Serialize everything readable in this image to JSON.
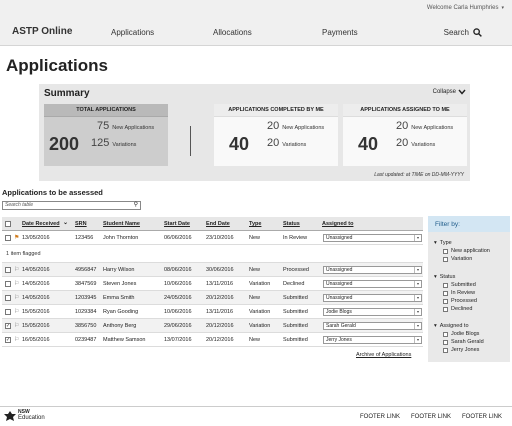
{
  "header": {
    "welcome": "Welcome Carla Humphries",
    "brand": "ASTP Online",
    "nav": [
      "Applications",
      "Allocations",
      "Payments"
    ],
    "search_label": "Search"
  },
  "page_title": "Applications",
  "summary": {
    "title": "Summary",
    "collapse_label": "Collapse",
    "total": {
      "title": "TOTAL APPLICATIONS",
      "count": "200",
      "new_count": "75",
      "new_label": "New Applications",
      "var_count": "125",
      "var_label": "Variations"
    },
    "completed": {
      "title": "APPLICATIONS COMPLETED BY ME",
      "count": "40",
      "new_count": "20",
      "new_label": "New Applications",
      "var_count": "20",
      "var_label": "Variations"
    },
    "assigned": {
      "title": "APPLICATIONS ASSIGNED TO ME",
      "count": "40",
      "new_count": "20",
      "new_label": "New Applications",
      "var_count": "20",
      "var_label": "Variations"
    },
    "last_updated": "Last updated: at TIME on DD-MM-YYYY"
  },
  "assess": {
    "title": "Applications to be assessed",
    "search_placeholder": "Search table",
    "columns": [
      "Date Received",
      "SRN",
      "Student Name",
      "Start Date",
      "End Date",
      "Type",
      "Status",
      "Assigned to"
    ],
    "flagged_text": "1 item flagged",
    "rows": [
      {
        "date": "13/05/2016",
        "srn": "123456",
        "name": "John Thornton",
        "start": "06/06/2016",
        "end": "23/10/2016",
        "type": "New",
        "status": "In Review",
        "assigned": "Unassigned",
        "checked": false,
        "flagged": true
      },
      {
        "date": "14/05/2016",
        "srn": "4956847",
        "name": "Harry Wilson",
        "start": "08/06/2016",
        "end": "30/06/2016",
        "type": "New",
        "status": "Processed",
        "assigned": "Unassigned",
        "checked": false,
        "flagged": false
      },
      {
        "date": "14/05/2016",
        "srn": "3847569",
        "name": "Steven Jones",
        "start": "10/06/2016",
        "end": "13/11/2016",
        "type": "Variation",
        "status": "Declined",
        "assigned": "Unassigned",
        "checked": false,
        "flagged": false
      },
      {
        "date": "14/05/2016",
        "srn": "1203945",
        "name": "Emma Smith",
        "start": "24/05/2016",
        "end": "20/12/2016",
        "type": "New",
        "status": "Submitted",
        "assigned": "Unassigned",
        "checked": false,
        "flagged": false
      },
      {
        "date": "15/05/2016",
        "srn": "1029384",
        "name": "Ryan Gooding",
        "start": "10/06/2016",
        "end": "13/11/2016",
        "type": "Variation",
        "status": "Submitted",
        "assigned": "Jodie Blogs",
        "checked": false,
        "flagged": false
      },
      {
        "date": "15/05/2016",
        "srn": "3856750",
        "name": "Anthony Berg",
        "start": "29/06/2016",
        "end": "20/12/2016",
        "type": "Variation",
        "status": "Submitted",
        "assigned": "Sarah Gerald",
        "checked": true,
        "flagged": false
      },
      {
        "date": "16/05/2016",
        "srn": "0239487",
        "name": "Matthew Samson",
        "start": "13/07/2016",
        "end": "20/12/2016",
        "type": "New",
        "status": "Submitted",
        "assigned": "Jerry Jones",
        "checked": true,
        "flagged": false
      }
    ],
    "archive_link": "Archive of Applications"
  },
  "filter": {
    "title": "Filter by:",
    "type": {
      "label": "Type",
      "options": [
        "New application",
        "Variation"
      ]
    },
    "status": {
      "label": "Status",
      "options": [
        "Submitted",
        "In Review",
        "Processed",
        "Declined"
      ]
    },
    "assigned": {
      "label": "Assigned to",
      "options": [
        "Jodie Blogs",
        "Sarah Gerald",
        "Jerry Jones"
      ]
    }
  },
  "footer": {
    "logo_text": "NSW",
    "logo_sub": "Education",
    "links": [
      "FOOTER LINK",
      "FOOTER LINK",
      "FOOTER LINK"
    ]
  },
  "colors": {
    "accent_blue": "#1f5c8a",
    "filter_header": "#d3e6f3",
    "flag": "#d07a1a"
  }
}
